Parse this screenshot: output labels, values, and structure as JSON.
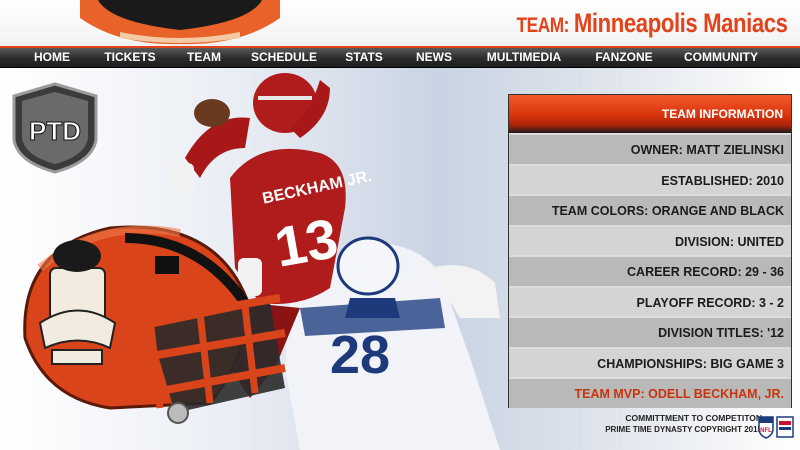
{
  "header": {
    "team_prefix": "TEAM:",
    "team_name": "Minneapolis Maniacs"
  },
  "nav": {
    "items": [
      "HOME",
      "TICKETS",
      "TEAM",
      "SCHEDULE",
      "STATS",
      "NEWS",
      "MULTIMEDIA",
      "FANZONE",
      "COMMUNITY"
    ]
  },
  "shield": {
    "text": "PTD"
  },
  "player": {
    "jersey_name": "BECKHAM JR.",
    "jersey_number": "13",
    "defender_number": "28"
  },
  "team_info": {
    "title": "TEAM INFORMATION",
    "rows": [
      "OWNER:  MATT ZIELINSKI",
      "ESTABLISHED: 2010",
      "TEAM COLORS: ORANGE AND BLACK",
      "DIVISION: UNITED",
      "CAREER RECORD: 29 - 36",
      "PLAYOFF RECORD: 3 - 2",
      "DIVISION TITLES:  '12",
      "CHAMPIONSHIPS: BIG GAME 3"
    ],
    "mvp": "TEAM MVP: ODELL BECKHAM, JR."
  },
  "footer": {
    "line1": "COMMITTMENT TO COMPETITON",
    "line2": "PRIME TIME DYNASTY COPYRIGHT 2015",
    "logo_text": "NFL"
  },
  "colors": {
    "accent": "#e2431a",
    "nav_bg": "#2b2b2b",
    "row_light": "#d4d4d4",
    "row_dark": "#b9b9b9"
  }
}
